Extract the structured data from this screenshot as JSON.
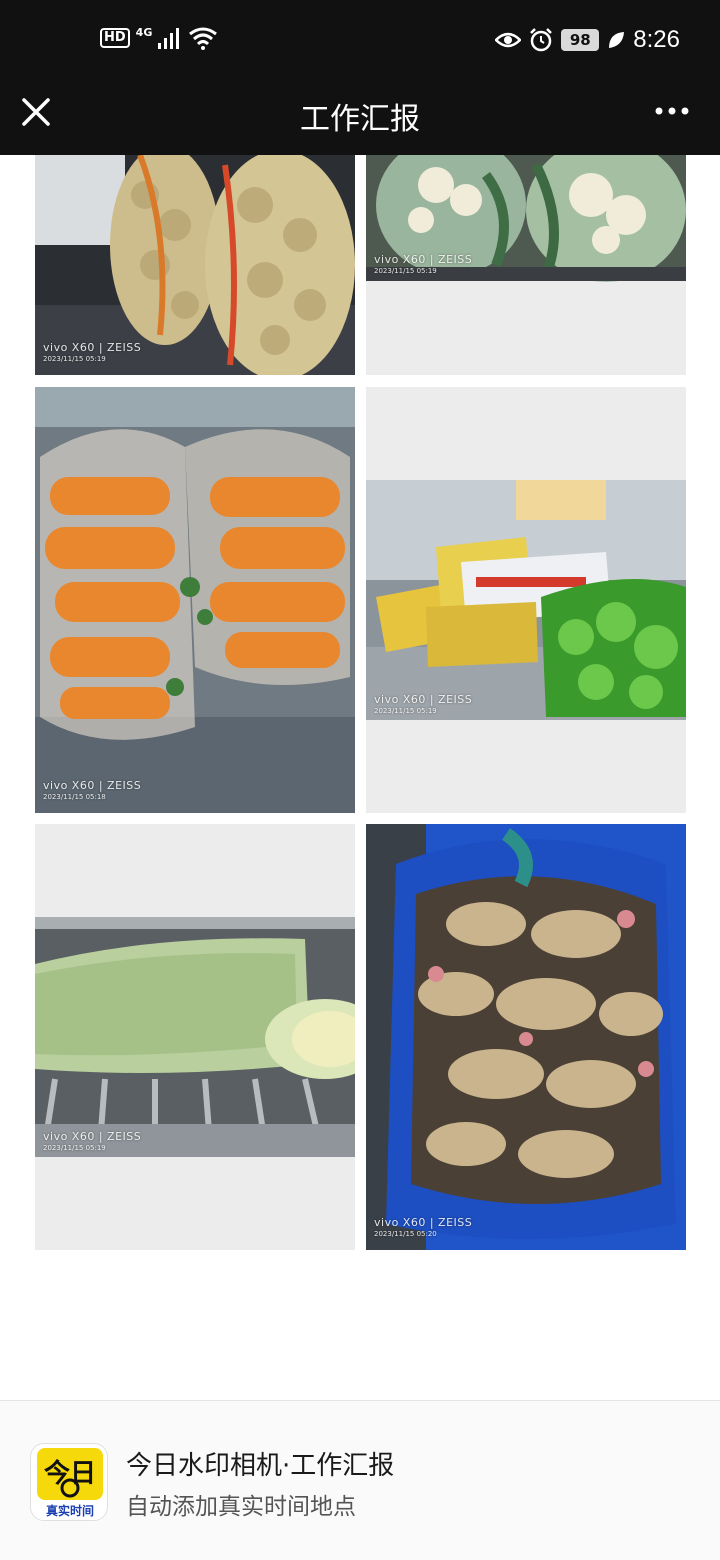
{
  "status_bar": {
    "hd": "HD",
    "network": "4G",
    "battery": "98",
    "time": "8:26",
    "icons": [
      "hd-icon",
      "signal-icon",
      "wifi-icon",
      "eye-icon",
      "alarm-icon",
      "battery-icon",
      "leaf-icon"
    ]
  },
  "header": {
    "title": "工作汇报",
    "close_icon": "close-icon",
    "more_icon": "more-dots-icon"
  },
  "photos": [
    {
      "subject": "potatoes",
      "brand": "vivo X60 | ZEISS",
      "date": "2023/11/15 05:19"
    },
    {
      "subject": "cauliflower",
      "brand": "vivo X60 | ZEISS",
      "date": "2023/11/15 05:19"
    },
    {
      "subject": "carrots",
      "brand": "vivo X60 | ZEISS",
      "date": "2023/11/15 05:18"
    },
    {
      "subject": "vegetable-crates",
      "brand": "vivo X60 | ZEISS",
      "date": "2023/11/15 05:19"
    },
    {
      "subject": "napa-cabbage",
      "brand": "vivo X60 | ZEISS",
      "date": "2023/11/15 05:19"
    },
    {
      "subject": "ginger",
      "brand": "vivo X60 | ZEISS",
      "date": "2023/11/15 05:20"
    }
  ],
  "footer": {
    "app_name": "今日水印相机·工作汇报",
    "app_tagline": "自动添加真实时间地点",
    "icon_top_text": "今日",
    "icon_bottom_text": "真实时间",
    "accent": "#f5d90a"
  }
}
